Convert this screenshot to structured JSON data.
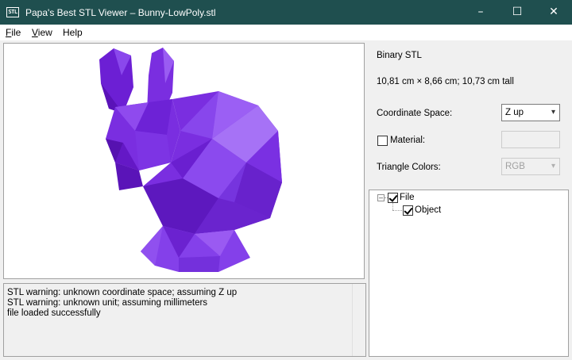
{
  "window": {
    "icon_text": "STL",
    "title": "Papa's Best STL Viewer – Bunny-LowPoly.stl",
    "minimize": "–",
    "maximize": "☐",
    "close": "✕"
  },
  "menu": [
    {
      "accel": "F",
      "rest": "ile"
    },
    {
      "accel": "V",
      "rest": "iew"
    },
    {
      "accel": "",
      "rest": "Help"
    }
  ],
  "log": {
    "lines": [
      "STL warning: unknown coordinate space; assuming Z up",
      "STL warning: unknown unit; assuming millimeters",
      "file loaded successfully"
    ]
  },
  "panel": {
    "format": "Binary STL",
    "dimensions": "10,81 cm × 8,66 cm; 10,73 cm tall",
    "coordinate_label": "Coordinate Space:",
    "coordinate_value": "Z up",
    "material_label": "Material:",
    "material_checked": false,
    "material_value": "",
    "colors_label": "Triangle Colors:",
    "colors_value": "RGB"
  },
  "tree": [
    {
      "label": "File",
      "checked": true,
      "expanded": true
    },
    {
      "label": "Object",
      "checked": true
    }
  ],
  "colors": {
    "titlebar": "#1f4f4f",
    "model": "#7a2ee0"
  }
}
